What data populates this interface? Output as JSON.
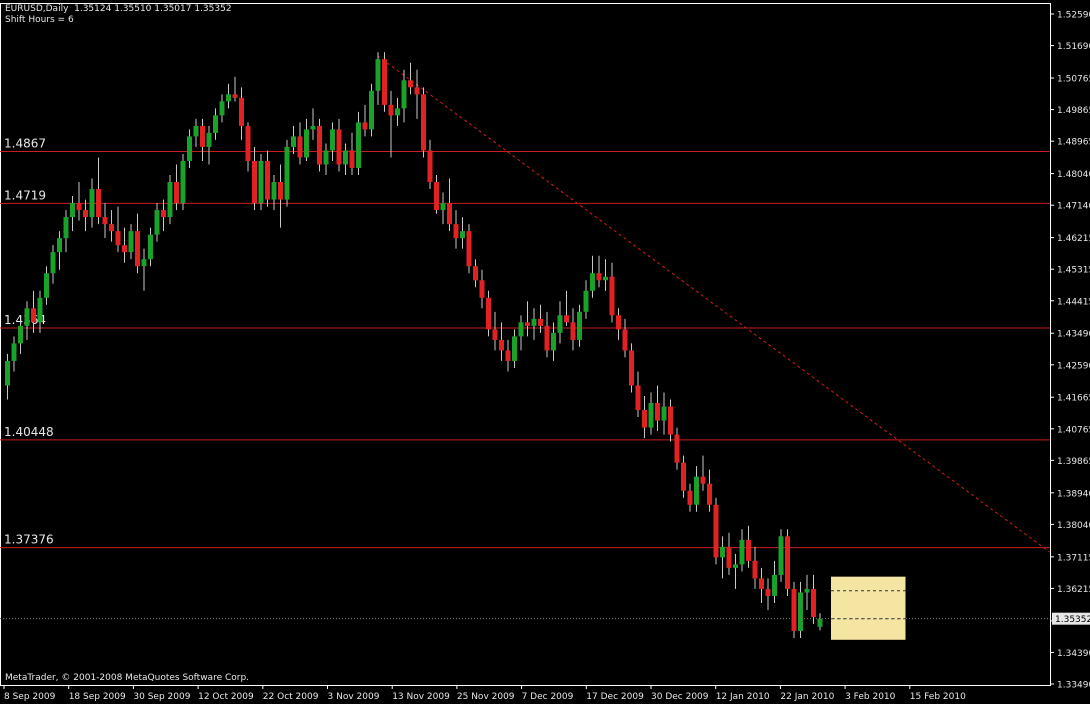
{
  "header": {
    "line1": "EURUSD,Daily  1.35124 1.35510 1.35017 1.35352",
    "line2": "Shift Hours = 6"
  },
  "copyright": "MetaTrader, © 2001-2008 MetaQuotes Software Corp.",
  "colors": {
    "background": "#000000",
    "up_candle": "#1aa12a",
    "down_candle": "#e22222",
    "wick": "#c8c8c8",
    "level_line": "#c81e1e",
    "trendline": "#d41e1e",
    "highlight_box": "#f4e6a2",
    "axis_text": "#e6e6e6",
    "current_price_box": "#e6e6e6"
  },
  "chart_data": {
    "type": "candlestick",
    "symbol": "EURUSD",
    "timeframe": "Daily",
    "ylim": [
      1.3349,
      1.5259
    ],
    "y_ticks": [
      "1.52590",
      "1.51690",
      "1.50765",
      "1.49865",
      "1.48965",
      "1.48040",
      "1.47140",
      "1.46215",
      "1.45315",
      "1.44415",
      "1.43490",
      "1.42590",
      "1.41665",
      "1.40765",
      "1.39865",
      "1.38940",
      "1.38040",
      "1.37115",
      "1.36215",
      "1.35290",
      "1.34390",
      "1.33490"
    ],
    "x_ticks": [
      "8 Sep 2009",
      "18 Sep 2009",
      "30 Sep 2009",
      "12 Oct 2009",
      "22 Oct 2009",
      "3 Nov 2009",
      "13 Nov 2009",
      "25 Nov 2009",
      "7 Dec 2009",
      "17 Dec 2009",
      "30 Dec 2009",
      "12 Jan 2010",
      "22 Jan 2010",
      "3 Feb 2010",
      "15 Feb 2010"
    ],
    "current_price": "1.35352",
    "horizontal_levels": [
      {
        "value": 1.4867,
        "label": "1.4867"
      },
      {
        "value": 1.4719,
        "label": "1.4719"
      },
      {
        "value": 1.4364,
        "label": "1.4364"
      },
      {
        "value": 1.40448,
        "label": "1.40448"
      },
      {
        "value": 1.37376,
        "label": "1.37376"
      }
    ],
    "trendline": {
      "from": {
        "bar": 57,
        "price": 1.514
      },
      "to": {
        "bar": 148,
        "price": 1.3895
      }
    },
    "highlight": {
      "from_bar": 128,
      "to_bar": 137,
      "high": 1.3655,
      "low": 1.3475,
      "dash_high": 1.3615,
      "dash_low": 1.3535
    },
    "candles": [
      [
        1.42,
        1.429,
        1.416,
        1.427
      ],
      [
        1.427,
        1.434,
        1.424,
        1.432
      ],
      [
        1.432,
        1.438,
        1.429,
        1.437
      ],
      [
        1.437,
        1.444,
        1.433,
        1.442
      ],
      [
        1.442,
        1.447,
        1.435,
        1.438
      ],
      [
        1.438,
        1.447,
        1.435,
        1.445
      ],
      [
        1.445,
        1.454,
        1.443,
        1.452
      ],
      [
        1.452,
        1.46,
        1.449,
        1.458
      ],
      [
        1.458,
        1.464,
        1.453,
        1.462
      ],
      [
        1.462,
        1.47,
        1.458,
        1.468
      ],
      [
        1.468,
        1.474,
        1.464,
        1.472
      ],
      [
        1.472,
        1.478,
        1.467,
        1.47
      ],
      [
        1.47,
        1.473,
        1.464,
        1.468
      ],
      [
        1.468,
        1.479,
        1.465,
        1.476
      ],
      [
        1.476,
        1.485,
        1.466,
        1.468
      ],
      [
        1.468,
        1.472,
        1.462,
        1.466
      ],
      [
        1.466,
        1.47,
        1.461,
        1.464
      ],
      [
        1.464,
        1.471,
        1.458,
        1.46
      ],
      [
        1.46,
        1.465,
        1.455,
        1.458
      ],
      [
        1.458,
        1.466,
        1.456,
        1.464
      ],
      [
        1.464,
        1.469,
        1.452,
        1.454
      ],
      [
        1.454,
        1.459,
        1.447,
        1.456
      ],
      [
        1.456,
        1.465,
        1.454,
        1.463
      ],
      [
        1.463,
        1.472,
        1.461,
        1.47
      ],
      [
        1.47,
        1.473,
        1.464,
        1.468
      ],
      [
        1.468,
        1.48,
        1.466,
        1.478
      ],
      [
        1.478,
        1.483,
        1.47,
        1.472
      ],
      [
        1.472,
        1.486,
        1.47,
        1.484
      ],
      [
        1.484,
        1.493,
        1.482,
        1.491
      ],
      [
        1.491,
        1.496,
        1.488,
        1.494
      ],
      [
        1.494,
        1.496,
        1.484,
        1.488
      ],
      [
        1.488,
        1.494,
        1.483,
        1.492
      ],
      [
        1.492,
        1.499,
        1.49,
        1.497
      ],
      [
        1.497,
        1.503,
        1.495,
        1.501
      ],
      [
        1.501,
        1.506,
        1.499,
        1.503
      ],
      [
        1.503,
        1.508,
        1.501,
        1.502
      ],
      [
        1.502,
        1.505,
        1.49,
        1.494
      ],
      [
        1.494,
        1.495,
        1.481,
        1.484
      ],
      [
        1.484,
        1.488,
        1.47,
        1.472
      ],
      [
        1.472,
        1.486,
        1.47,
        1.484
      ],
      [
        1.484,
        1.487,
        1.471,
        1.473
      ],
      [
        1.473,
        1.48,
        1.47,
        1.478
      ],
      [
        1.478,
        1.483,
        1.465,
        1.473
      ],
      [
        1.473,
        1.49,
        1.471,
        1.488
      ],
      [
        1.488,
        1.494,
        1.486,
        1.491
      ],
      [
        1.491,
        1.495,
        1.483,
        1.485
      ],
      [
        1.485,
        1.496,
        1.484,
        1.493
      ],
      [
        1.493,
        1.499,
        1.49,
        1.494
      ],
      [
        1.494,
        1.496,
        1.481,
        1.483
      ],
      [
        1.483,
        1.489,
        1.48,
        1.487
      ],
      [
        1.487,
        1.495,
        1.484,
        1.493
      ],
      [
        1.493,
        1.496,
        1.481,
        1.483
      ],
      [
        1.483,
        1.489,
        1.48,
        1.487
      ],
      [
        1.487,
        1.492,
        1.48,
        1.482
      ],
      [
        1.482,
        1.498,
        1.48,
        1.495
      ],
      [
        1.495,
        1.5,
        1.491,
        1.493
      ],
      [
        1.493,
        1.506,
        1.491,
        1.504
      ],
      [
        1.504,
        1.515,
        1.5,
        1.513
      ],
      [
        1.513,
        1.515,
        1.498,
        1.5
      ],
      [
        1.5,
        1.504,
        1.485,
        1.497
      ],
      [
        1.497,
        1.502,
        1.494,
        1.499
      ],
      [
        1.499,
        1.51,
        1.495,
        1.507
      ],
      [
        1.507,
        1.512,
        1.503,
        1.505
      ],
      [
        1.505,
        1.51,
        1.496,
        1.503
      ],
      [
        1.503,
        1.505,
        1.485,
        1.487
      ],
      [
        1.487,
        1.49,
        1.476,
        1.478
      ],
      [
        1.478,
        1.48,
        1.469,
        1.47
      ],
      [
        1.47,
        1.475,
        1.466,
        1.472
      ],
      [
        1.472,
        1.479,
        1.464,
        1.466
      ],
      [
        1.466,
        1.47,
        1.459,
        1.462
      ],
      [
        1.462,
        1.468,
        1.459,
        1.464
      ],
      [
        1.464,
        1.466,
        1.452,
        1.454
      ],
      [
        1.454,
        1.456,
        1.448,
        1.45
      ],
      [
        1.45,
        1.453,
        1.442,
        1.445
      ],
      [
        1.445,
        1.447,
        1.434,
        1.436
      ],
      [
        1.436,
        1.441,
        1.43,
        1.433
      ],
      [
        1.433,
        1.438,
        1.427,
        1.43
      ],
      [
        1.43,
        1.433,
        1.424,
        1.427
      ],
      [
        1.427,
        1.436,
        1.425,
        1.434
      ],
      [
        1.434,
        1.44,
        1.43,
        1.438
      ],
      [
        1.438,
        1.444,
        1.434,
        1.437
      ],
      [
        1.437,
        1.442,
        1.433,
        1.439
      ],
      [
        1.439,
        1.443,
        1.435,
        1.437
      ],
      [
        1.437,
        1.441,
        1.428,
        1.43
      ],
      [
        1.43,
        1.438,
        1.427,
        1.435
      ],
      [
        1.435,
        1.444,
        1.432,
        1.44
      ],
      [
        1.44,
        1.447,
        1.437,
        1.438
      ],
      [
        1.438,
        1.442,
        1.43,
        1.433
      ],
      [
        1.433,
        1.443,
        1.431,
        1.441
      ],
      [
        1.441,
        1.45,
        1.439,
        1.447
      ],
      [
        1.447,
        1.457,
        1.445,
        1.452
      ],
      [
        1.452,
        1.457,
        1.448,
        1.45
      ],
      [
        1.45,
        1.456,
        1.447,
        1.451
      ],
      [
        1.451,
        1.455,
        1.438,
        1.44
      ],
      [
        1.44,
        1.442,
        1.433,
        1.436
      ],
      [
        1.436,
        1.439,
        1.428,
        1.43
      ],
      [
        1.43,
        1.432,
        1.418,
        1.42
      ],
      [
        1.42,
        1.424,
        1.411,
        1.413
      ],
      [
        1.413,
        1.417,
        1.405,
        1.408
      ],
      [
        1.408,
        1.418,
        1.406,
        1.415
      ],
      [
        1.415,
        1.42,
        1.407,
        1.41
      ],
      [
        1.41,
        1.418,
        1.406,
        1.414
      ],
      [
        1.414,
        1.416,
        1.404,
        1.406
      ],
      [
        1.406,
        1.408,
        1.396,
        1.398
      ],
      [
        1.398,
        1.4,
        1.388,
        1.39
      ],
      [
        1.39,
        1.392,
        1.384,
        1.386
      ],
      [
        1.386,
        1.397,
        1.384,
        1.394
      ],
      [
        1.394,
        1.4,
        1.39,
        1.392
      ],
      [
        1.392,
        1.396,
        1.384,
        1.386
      ],
      [
        1.386,
        1.388,
        1.369,
        1.371
      ],
      [
        1.371,
        1.377,
        1.365,
        1.374
      ],
      [
        1.374,
        1.378,
        1.366,
        1.368
      ],
      [
        1.368,
        1.372,
        1.362,
        1.369
      ],
      [
        1.369,
        1.379,
        1.367,
        1.376
      ],
      [
        1.376,
        1.38,
        1.368,
        1.37
      ],
      [
        1.37,
        1.374,
        1.362,
        1.365
      ],
      [
        1.365,
        1.368,
        1.358,
        1.362
      ],
      [
        1.362,
        1.365,
        1.356,
        1.36
      ],
      [
        1.36,
        1.37,
        1.358,
        1.366
      ],
      [
        1.366,
        1.379,
        1.364,
        1.377
      ],
      [
        1.377,
        1.379,
        1.36,
        1.362
      ],
      [
        1.362,
        1.364,
        1.348,
        1.35
      ],
      [
        1.35,
        1.364,
        1.348,
        1.361
      ],
      [
        1.361,
        1.366,
        1.356,
        1.362
      ],
      [
        1.362,
        1.366,
        1.352,
        1.354
      ],
      [
        1.3512,
        1.3551,
        1.3502,
        1.3535
      ]
    ]
  }
}
